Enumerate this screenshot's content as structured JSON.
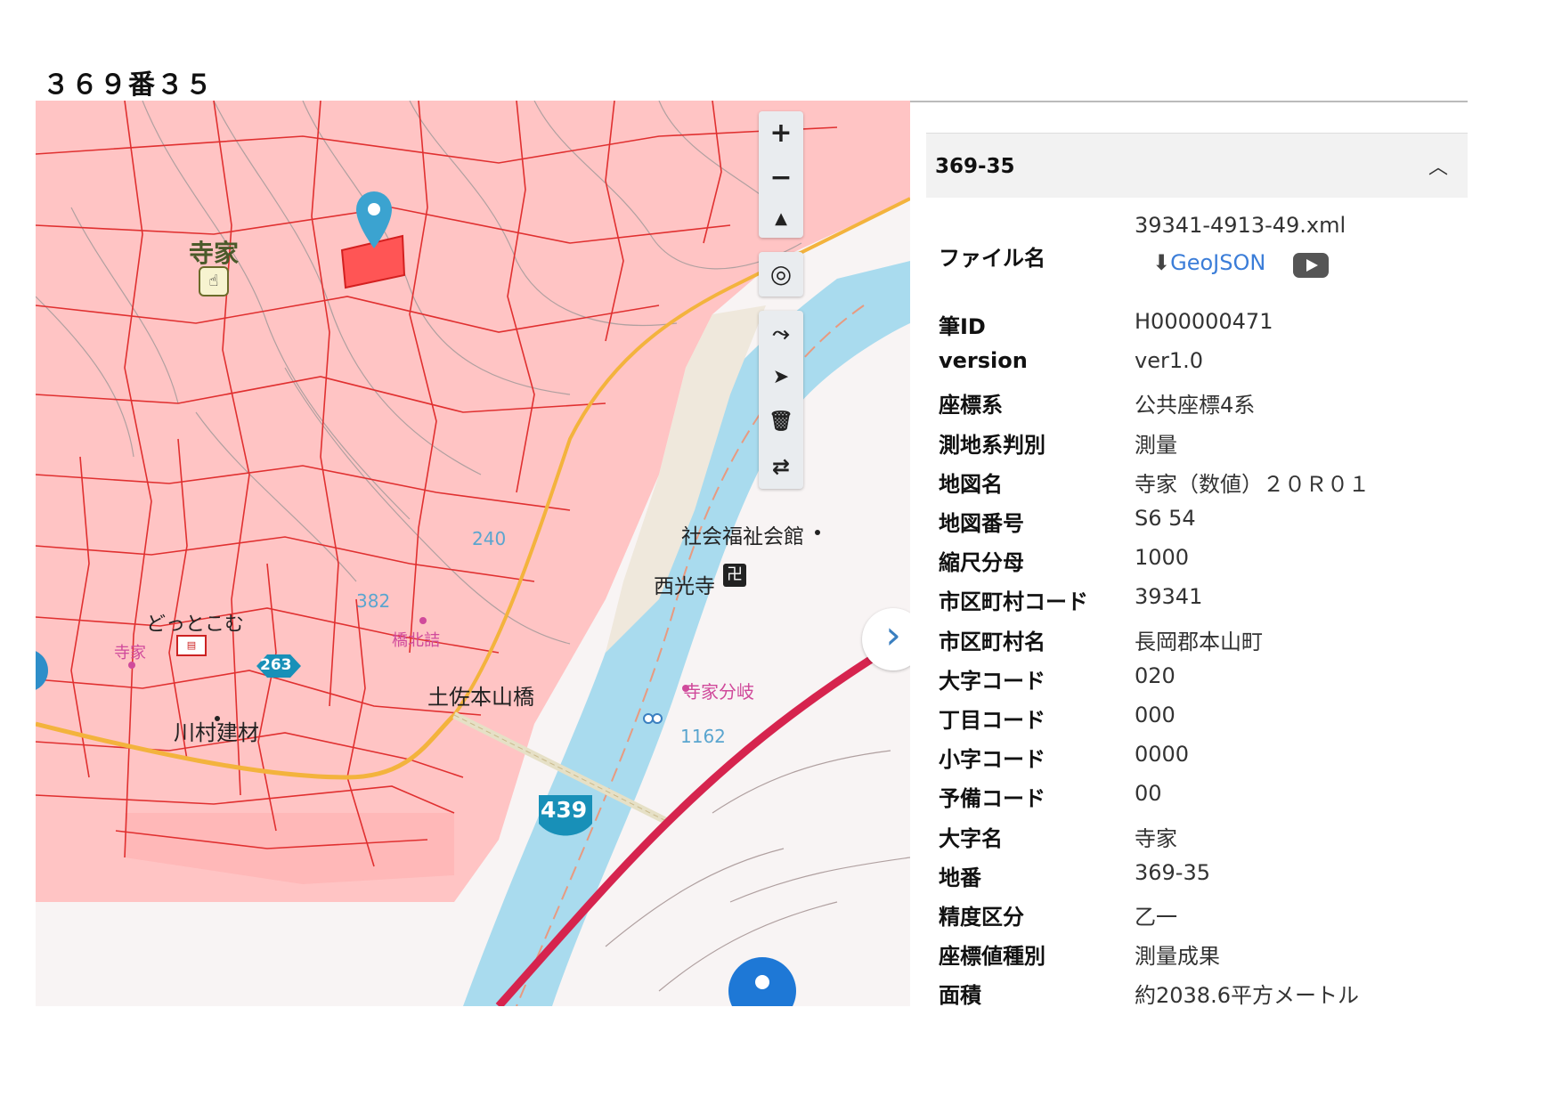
{
  "page": {
    "title": "３６９番３５"
  },
  "map": {
    "labels": {
      "teraie_area": "寺家",
      "dottodomu": "どっとこむ",
      "teraie_station": "寺家",
      "kawamura": "川村建材",
      "kyohokuzume": "橋北詰",
      "tosa_bridge": "土佐本山橋",
      "shakai_fukushi": "社会福祉会館",
      "saikoji": "西光寺",
      "teraie_bunki": "寺家分岐",
      "elev_240": "240",
      "elev_382": "382",
      "elev_1162": "1162",
      "route_263": "263",
      "route_439": "439"
    },
    "controls": {
      "zoom_in": "+",
      "zoom_out": "−",
      "compass": "▲",
      "locate": "◎",
      "draw": "⤳",
      "select": "➤",
      "delete": "🗑",
      "swap": "⇄",
      "expand": "›"
    },
    "colors": {
      "parcel_fill": "#ffc4c4",
      "parcel_line": "#e03030",
      "river": "#a9dbee",
      "highlight": "#ff4d4d",
      "marker": "#3ba3d0"
    }
  },
  "panel": {
    "header_title": "369-35",
    "collapse_icon": "︿",
    "file_label": "ファイル名",
    "file_value": "39341-4913-49.xml",
    "geojson_label": "GeoJSON",
    "rows": [
      {
        "key": "筆ID",
        "value": "H000000471"
      },
      {
        "key": "version",
        "value": "ver1.0"
      },
      {
        "key": "座標系",
        "value": "公共座標4系"
      },
      {
        "key": "測地系判別",
        "value": "測量"
      },
      {
        "key": "地図名",
        "value": "寺家（数値）２０Ｒ０１"
      },
      {
        "key": "地図番号",
        "value": "S6 54"
      },
      {
        "key": "縮尺分母",
        "value": "1000"
      },
      {
        "key": "市区町村コード",
        "value": "39341"
      },
      {
        "key": "市区町村名",
        "value": "長岡郡本山町"
      },
      {
        "key": "大字コード",
        "value": "020"
      },
      {
        "key": "丁目コード",
        "value": "000"
      },
      {
        "key": "小字コード",
        "value": "0000"
      },
      {
        "key": "予備コード",
        "value": "00"
      },
      {
        "key": "大字名",
        "value": "寺家"
      },
      {
        "key": "地番",
        "value": "369-35"
      },
      {
        "key": "精度区分",
        "value": "乙一"
      },
      {
        "key": "座標値種別",
        "value": "測量成果"
      },
      {
        "key": "面積",
        "value": "約2038.6平方メートル"
      }
    ]
  }
}
